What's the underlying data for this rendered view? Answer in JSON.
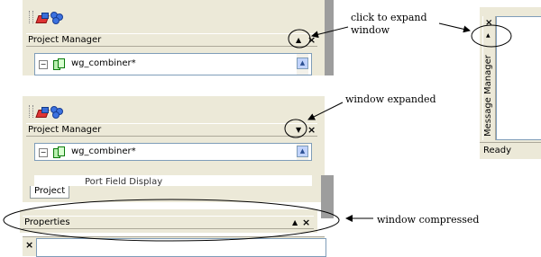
{
  "panel_top": {
    "title": "Project Manager",
    "collapse_glyph": "▲",
    "close_glyph": "×",
    "tree_item": "wg_combiner*",
    "expander": "−"
  },
  "panel_mid": {
    "title": "Project Manager",
    "collapse_glyph": "▼",
    "close_glyph": "×",
    "tree_item": "wg_combiner*",
    "expander": "−",
    "cut_item": "Port Field Display",
    "tab": "Project"
  },
  "panel_bottom": {
    "title": "Properties",
    "collapse_glyph": "▲",
    "close_glyph": "×",
    "close_glyph_left": "×"
  },
  "message_panel": {
    "title": "Message Manager",
    "close_glyph": "×",
    "arrow_glyph": "▲",
    "status": "Ready"
  },
  "annotations": {
    "click_expand_line1": "click to expand",
    "click_expand_line2": "window",
    "expanded": "window expanded",
    "compressed": "window compressed"
  },
  "icons": [
    "toolbar-grip-icon",
    "create-object-icon",
    "connect-icon",
    "tree-expander-icon",
    "project-icon",
    "scroll-up-icon"
  ],
  "colors": {
    "panel": "#ece9d8",
    "border": "#7f9db9",
    "annotation_ink": "#000000"
  }
}
